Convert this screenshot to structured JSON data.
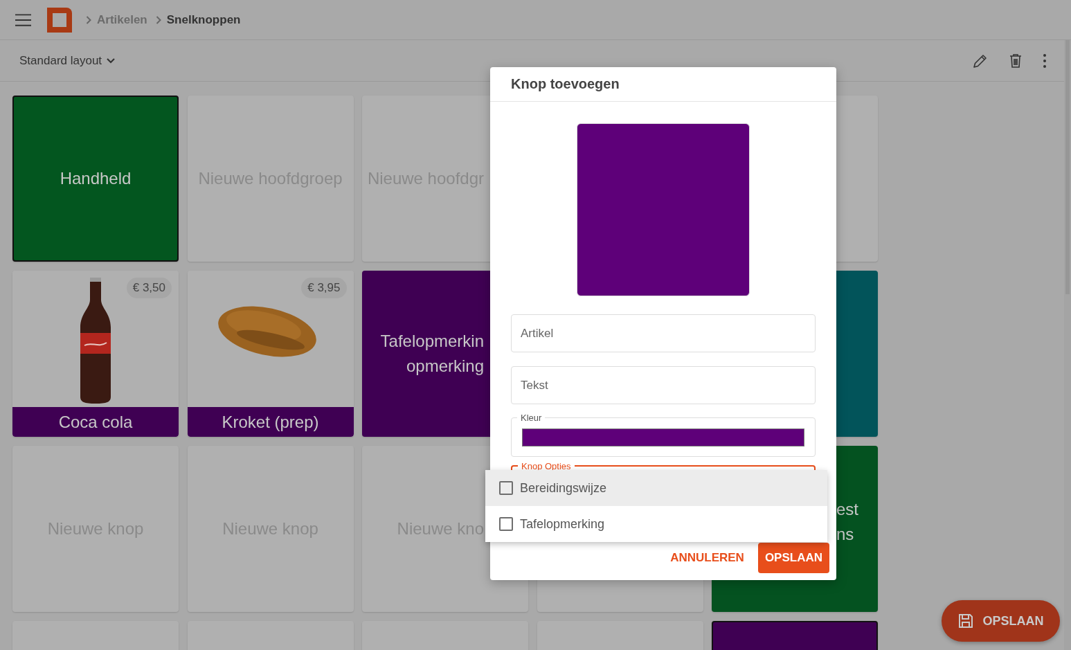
{
  "breadcrumb": [
    {
      "label": "Artikelen",
      "current": false
    },
    {
      "label": "Snelknoppen",
      "current": true
    }
  ],
  "toolbar": {
    "layout": "Standard layout"
  },
  "tiles": [
    {
      "kind": "button",
      "lines": [
        "Handheld"
      ],
      "color": "#03561f",
      "selected": true
    },
    {
      "kind": "empty",
      "lines": [
        "Nieuwe hoofdgroep"
      ],
      "color": "#b0b0b0",
      "selected": false
    },
    {
      "kind": "empty",
      "lines": [
        "Nieuwe hoofdgr"
      ],
      "color": "#b0b0b0",
      "selected": false
    },
    {
      "kind": "covered"
    },
    {
      "kind": "empty",
      "color": "#b0b0b0",
      "selected": false
    },
    {
      "kind": "product",
      "price": "€ 3,50",
      "lines": [
        "Coca cola"
      ],
      "color": "#3f0053",
      "selected": false
    },
    {
      "kind": "product",
      "price": "€ 3,95",
      "lines": [
        "Kroket (prep)"
      ],
      "color": "#3f0053",
      "selected": false
    },
    {
      "kind": "button",
      "lines": [
        "Tafelopmerkin",
        "opmerking"
      ],
      "color": "#3f0053",
      "selected": false
    },
    {
      "kind": "covered"
    },
    {
      "kind": "button",
      "color": "#02545a",
      "selected": false
    },
    {
      "kind": "empty",
      "lines": [
        "Nieuwe knop"
      ],
      "color": "#b0b0b0",
      "selected": false
    },
    {
      "kind": "empty",
      "lines": [
        "Nieuwe knop"
      ],
      "color": "#b0b0b0",
      "selected": false
    },
    {
      "kind": "empty",
      "lines": [
        "Nieuwe kno"
      ],
      "color": "#b0b0b0",
      "selected": false
    },
    {
      "kind": "empty",
      "color": "#b0b0b0",
      "selected": false
    },
    {
      "kind": "button",
      "lines": [
        "est",
        "ns"
      ],
      "color": "#045220",
      "selected": false
    },
    {
      "kind": "empty",
      "color": "#b0b0b0",
      "selected": false
    },
    {
      "kind": "empty",
      "color": "#b0b0b0",
      "selected": false
    },
    {
      "kind": "empty",
      "color": "#b0b0b0",
      "selected": false
    },
    {
      "kind": "empty",
      "color": "#b0b0b0",
      "selected": false
    },
    {
      "kind": "button",
      "color": "#3f0053",
      "selected": true
    }
  ],
  "fab": {
    "label": "OPSLAAN"
  },
  "dialog": {
    "title": "Knop toevoegen",
    "color": "#5e0079",
    "fields": [
      {
        "placeholder": "Artikel"
      },
      {
        "placeholder": "Tekst"
      }
    ],
    "color_label": "Kleur",
    "options_label": "Knop Opties",
    "menu": [
      {
        "label": "Bereidingswijze",
        "checked": false,
        "highlighted": true
      },
      {
        "label": "Tafelopmerking",
        "checked": false,
        "highlighted": false
      }
    ],
    "buttons": [
      {
        "label": "ANNULEREN",
        "kind": "text"
      },
      {
        "label": "OPSLAAN",
        "kind": "filled"
      }
    ]
  }
}
